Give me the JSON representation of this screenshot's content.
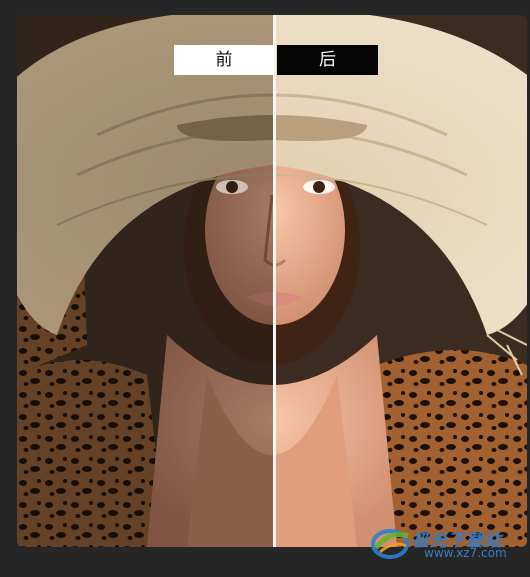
{
  "compare": {
    "before_label": "前",
    "after_label": "后"
  },
  "watermark": {
    "name": "极光下载站",
    "url": "www.xz7.com"
  },
  "colors": {
    "background": "#262626",
    "before_label_bg": "#ffffff",
    "after_label_bg": "#050505",
    "divider": "#f5f5f5",
    "watermark_blue": "#2b7fd4"
  },
  "icons": {
    "watermark_logo": "aurora-logo-icon"
  }
}
